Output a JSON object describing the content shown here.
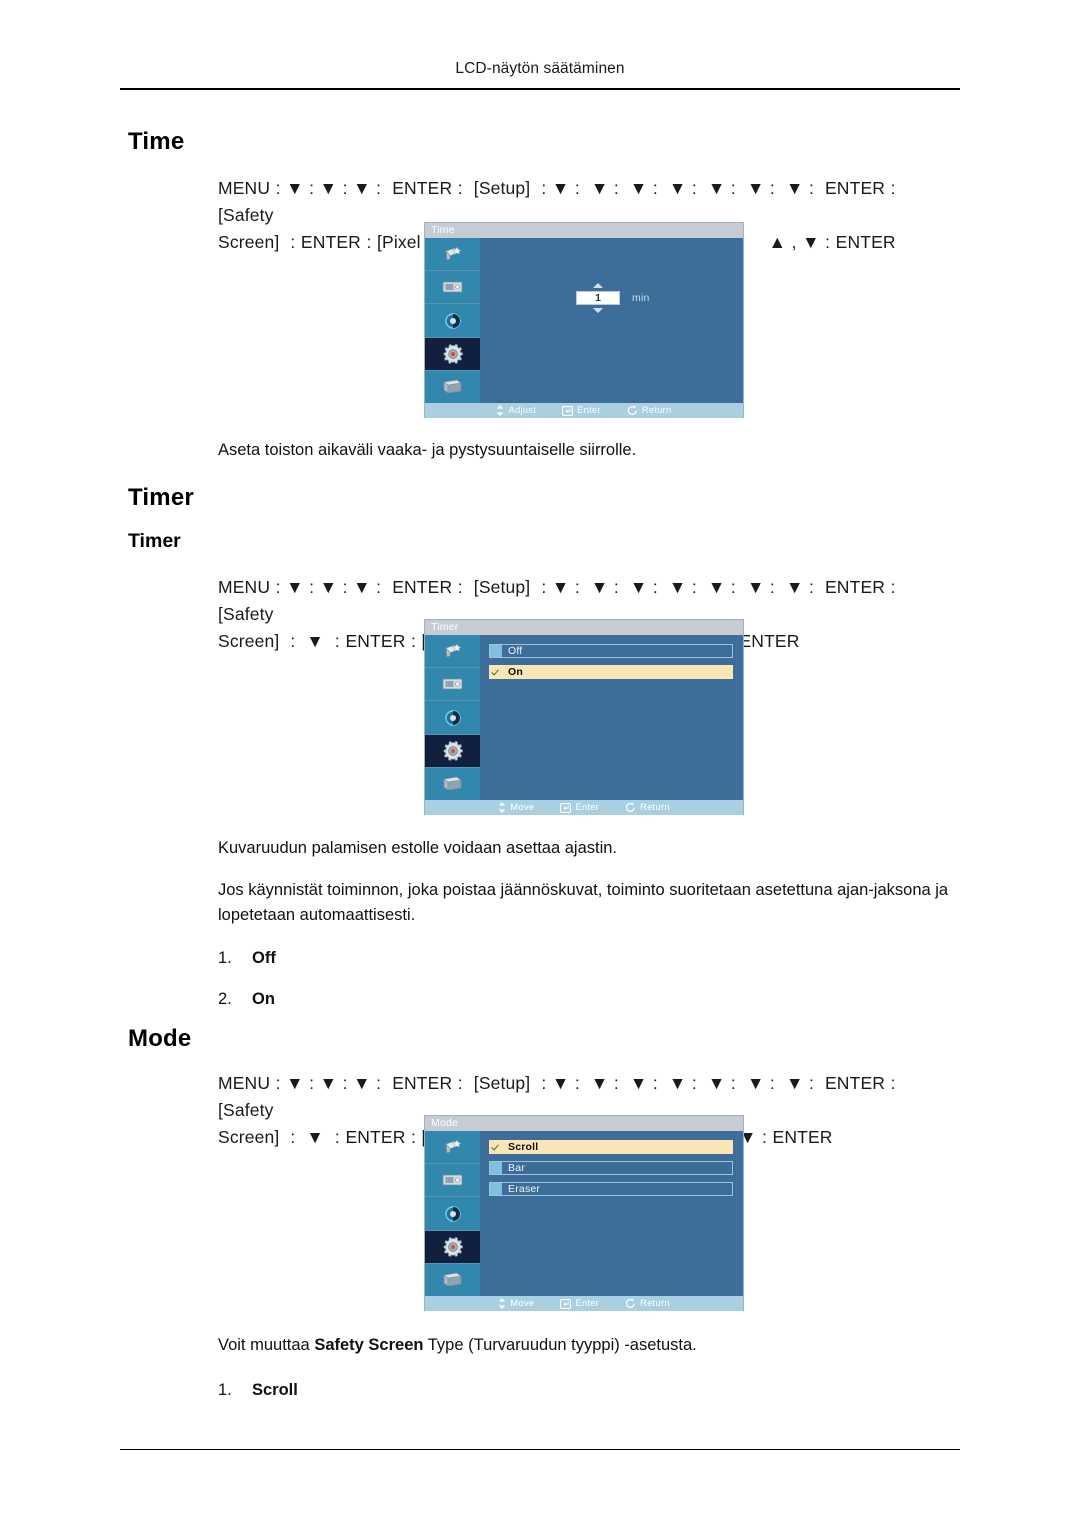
{
  "page": {
    "running_head": "LCD-näytön säätäminen"
  },
  "sections": [
    {
      "id": "time",
      "heading": "Time",
      "nav_path": "MENU : ▼ : ▼ : ▼ :  ENTER :  [Setup]  : ▼ :  ▼ :  ▼ :  ▼ :  ▼ :  ▼ :  ▼ :  ENTER :  [Safety\nScreen]  : ENTER : [Pixel Shift] :     ▼ : ▼ : ▼ : ENTER : [Time] :     ▲ , ▼ : ENTER",
      "caption": "Aseta toiston aikaväli vaaka- ja pystysuuntaiselle siirrolle."
    },
    {
      "id": "timer",
      "heading": "Timer",
      "subheading": "Timer",
      "nav_path": "MENU : ▼ : ▼ : ▼ :  ENTER :  [Setup]  : ▼ :  ▼ :  ▼ :  ▼ :  ▼ :  ▼ :  ▼ :  ENTER :  [Safety\nScreen]  :  ▼  : ENTER : [Timer] : ENTER : [Timer] :       ▲ , ▼ : ENTER",
      "paragraph_1": "Kuvaruudun palamisen estolle voidaan asettaa ajastin.",
      "paragraph_2": "Jos käynnistät toiminnon, joka poistaa jäännöskuvat, toiminto suoritetaan asetettuna ajan-jaksona ja lopetetaan automaattisesti.",
      "list": [
        {
          "num": "1.",
          "label": "Off"
        },
        {
          "num": "2.",
          "label": "On"
        }
      ]
    },
    {
      "id": "mode",
      "heading": "Mode",
      "nav_path": "MENU : ▼ : ▼ : ▼ :  ENTER :  [Setup]  : ▼ :  ▼ :  ▼ :  ▼ :  ▼ :  ▼ :  ▼ :  ENTER :  [Safety\nScreen]  :  ▼  : ENTER : [Timer] :     ▼ : ENTER : [Mode] :   ▲ , ▼ : ENTER",
      "caption_prefix": "Voit muuttaa ",
      "caption_bold": "Safety Screen",
      "caption_suffix": " Type (Turvaruudun tyyppi) -asetusta.",
      "list": [
        {
          "num": "1.",
          "label": "Scroll"
        }
      ]
    }
  ],
  "osd_panels": [
    {
      "id": "osd-time",
      "title": "Time",
      "type": "spinner",
      "value": "1",
      "unit": "min",
      "footer": [
        {
          "icon": "updown-arrows-icon",
          "label": "Adjust"
        },
        {
          "icon": "enter-key-icon",
          "label": "Enter"
        },
        {
          "icon": "return-arrow-icon",
          "label": "Return"
        }
      ],
      "rail": [
        {
          "icon": "picture-icon",
          "active": false
        },
        {
          "icon": "screen-icon",
          "active": false
        },
        {
          "icon": "sound-icon",
          "active": false
        },
        {
          "icon": "setup-gear-icon",
          "active": true
        },
        {
          "icon": "multi-control-icon",
          "active": false
        }
      ]
    },
    {
      "id": "osd-timer",
      "title": "Timer",
      "type": "options",
      "options": [
        {
          "label": "Off",
          "selected": false
        },
        {
          "label": "On",
          "selected": true
        }
      ],
      "footer": [
        {
          "icon": "updown-arrows-icon",
          "label": "Move"
        },
        {
          "icon": "enter-key-icon",
          "label": "Enter"
        },
        {
          "icon": "return-arrow-icon",
          "label": "Return"
        }
      ],
      "rail": [
        {
          "icon": "picture-icon",
          "active": false
        },
        {
          "icon": "screen-icon",
          "active": false
        },
        {
          "icon": "sound-icon",
          "active": false
        },
        {
          "icon": "setup-gear-icon",
          "active": true
        },
        {
          "icon": "multi-control-icon",
          "active": false
        }
      ]
    },
    {
      "id": "osd-mode",
      "title": "Mode",
      "type": "options",
      "options": [
        {
          "label": "Scroll",
          "selected": true
        },
        {
          "label": "Bar",
          "selected": false
        },
        {
          "label": "Eraser",
          "selected": false
        }
      ],
      "footer": [
        {
          "icon": "updown-arrows-icon",
          "label": "Move"
        },
        {
          "icon": "enter-key-icon",
          "label": "Enter"
        },
        {
          "icon": "return-arrow-icon",
          "label": "Return"
        }
      ],
      "rail": [
        {
          "icon": "picture-icon",
          "active": false
        },
        {
          "icon": "screen-icon",
          "active": false
        },
        {
          "icon": "sound-icon",
          "active": false
        },
        {
          "icon": "setup-gear-icon",
          "active": true
        },
        {
          "icon": "multi-control-icon",
          "active": false
        }
      ]
    }
  ],
  "colors": {
    "osd_background": "#3d6e99",
    "osd_titlebar": "#c5ccd4",
    "osd_footer": "#a9cfe0",
    "osd_rail": "#3287ad",
    "osd_rail_active": "#11203f",
    "selected_row": "#fae5b4"
  }
}
